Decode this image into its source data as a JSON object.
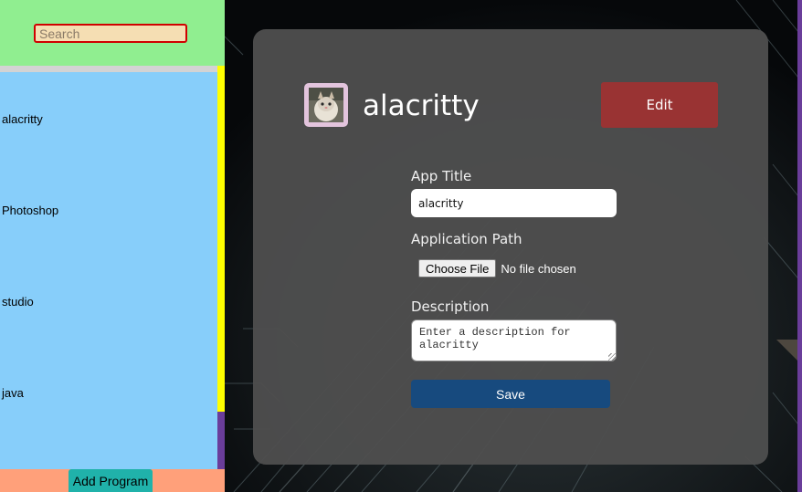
{
  "sidebar": {
    "search": {
      "placeholder": "Search"
    },
    "programs": [
      {
        "label": "alacritty"
      },
      {
        "label": "Photoshop"
      },
      {
        "label": "studio"
      },
      {
        "label": "java"
      }
    ],
    "add_button_label": "Add Program"
  },
  "detail": {
    "app_name": "alacritty",
    "edit_label": "Edit",
    "app_title_label": "App Title",
    "app_title_value": "alacritty",
    "app_path_label": "Application Path",
    "choose_file_label": "Choose File",
    "file_status": "No file chosen",
    "description_label": "Description",
    "description_placeholder": "Enter a description for alacritty",
    "save_label": "Save"
  },
  "colors": {
    "search_area": "#90ee90",
    "program_list": "#87cefa",
    "scrollbar_thumb": "#ffff00",
    "footer": "#ffa07a",
    "add_button": "#20b2aa",
    "edit_button": "#993333",
    "save_button": "#174a7e",
    "panel": "#4e4e4e"
  },
  "icons": {
    "avatar": "cat-avatar-image"
  }
}
